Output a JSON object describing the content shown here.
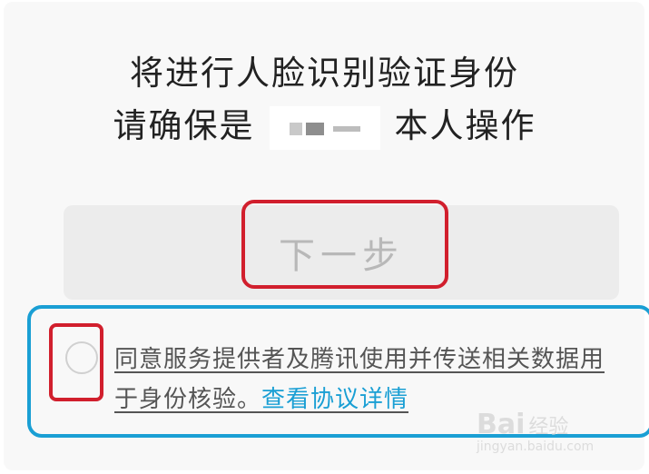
{
  "prompt": {
    "line1": "将进行人脸识别验证身份",
    "line2_prefix": "请确保是",
    "line2_suffix": "本人操作"
  },
  "next_button": {
    "label": "下一步"
  },
  "agreement": {
    "text": "同意服务提供者及腾讯使用并传送相关数据用于身份核验。",
    "link": "查看协议详情",
    "checked": false
  },
  "watermark": {
    "logo": "Bai",
    "text": "经验",
    "url": "jingyan.baidu.com"
  },
  "colors": {
    "annotation_red": "#d11f2d",
    "annotation_blue": "#1a9fd4",
    "link": "#1a9fd4",
    "disabled_text": "#b8b8b8"
  }
}
